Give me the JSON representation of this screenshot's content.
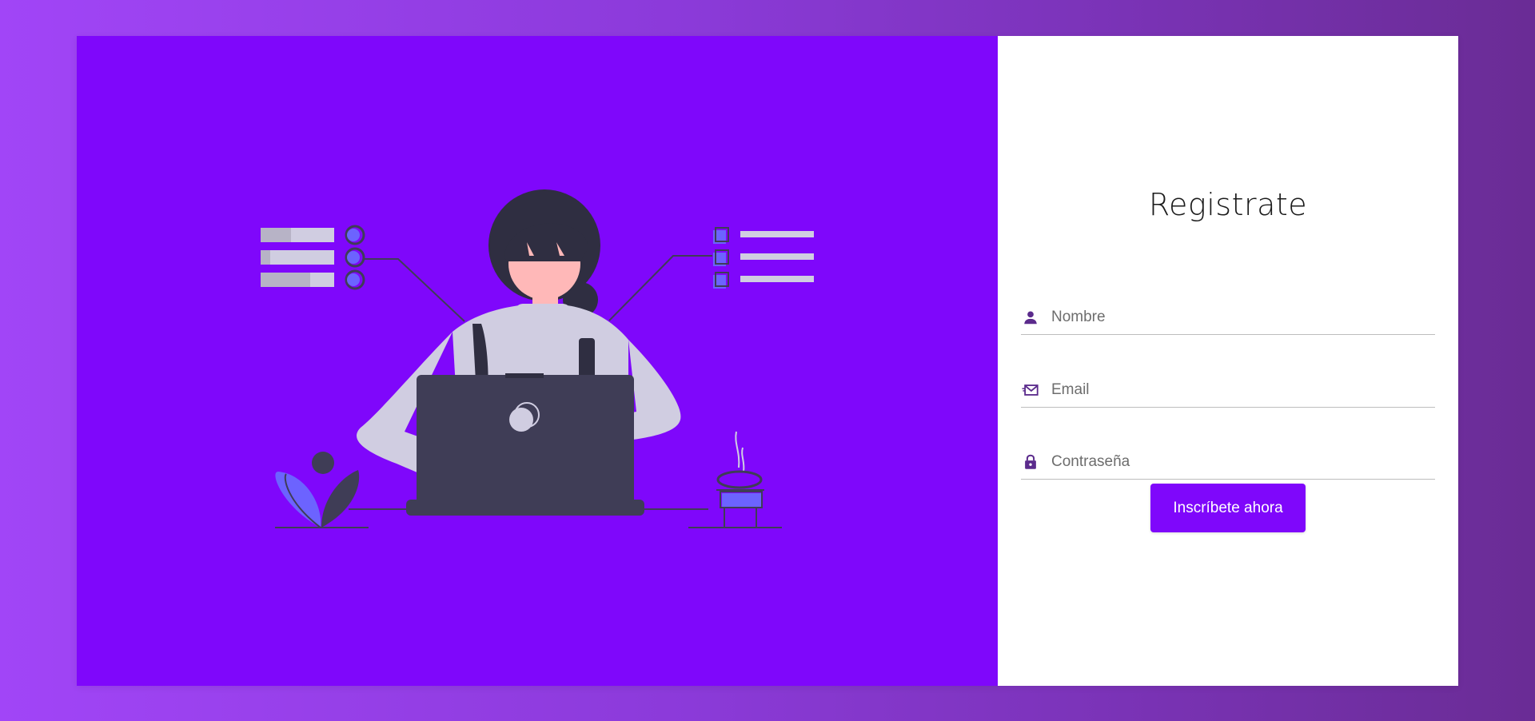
{
  "form": {
    "title": "Registrate",
    "fields": [
      {
        "name": "name",
        "icon": "person-icon",
        "placeholder": "Nombre",
        "value": ""
      },
      {
        "name": "email",
        "icon": "email-icon",
        "placeholder": "Email",
        "value": ""
      },
      {
        "name": "password",
        "icon": "lock-icon",
        "placeholder": "Contraseña",
        "value": ""
      }
    ],
    "submit_label": "Inscríbete ahora"
  },
  "colors": {
    "accent": "#7f07fb",
    "icon": "#5b2b8c",
    "background_gradient_start": "#a145f7",
    "background_gradient_end": "#6a2c95"
  },
  "illustration": {
    "subject": "woman-working-on-laptop-illustration"
  }
}
